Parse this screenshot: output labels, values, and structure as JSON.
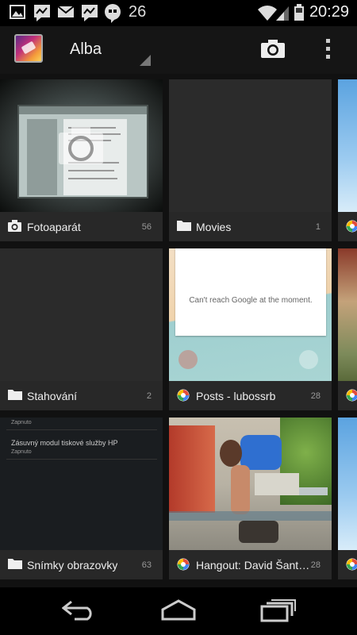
{
  "status_bar": {
    "notification_count": "26",
    "time": "20:29",
    "icons": [
      "gallery-icon",
      "hangouts-icon",
      "gmail-icon",
      "hangouts-icon",
      "quote-icon",
      "wifi-icon",
      "signal-icon",
      "battery-icon"
    ]
  },
  "action_bar": {
    "title": "Alba",
    "camera_icon": "camera-icon",
    "overflow_icon": "overflow-menu-icon"
  },
  "albums": [
    {
      "name": "Fotoaparát",
      "count": "56",
      "icon": "camera-icon"
    },
    {
      "name": "Movies",
      "count": "1",
      "icon": "folder-icon"
    },
    {
      "name": "Stahování",
      "count": "2",
      "icon": "folder-icon"
    },
    {
      "name": "Posts - lubossrb",
      "count": "28",
      "icon": "picasa-icon"
    },
    {
      "name": "Snímky obrazovky",
      "count": "63",
      "icon": "folder-icon"
    },
    {
      "name": "Hangout: David Šantor…",
      "count": "28",
      "icon": "picasa-icon"
    }
  ],
  "screenshot_preview": {
    "line1": "Zapnuto",
    "line2": "Zásuvný modul tiskové služby HP",
    "line3": "Zapnuto"
  },
  "posts_preview": {
    "message": "Can't reach Google at the moment."
  },
  "colors": {
    "accent_blue": "#1a73e8",
    "label_bar": "#282828"
  }
}
